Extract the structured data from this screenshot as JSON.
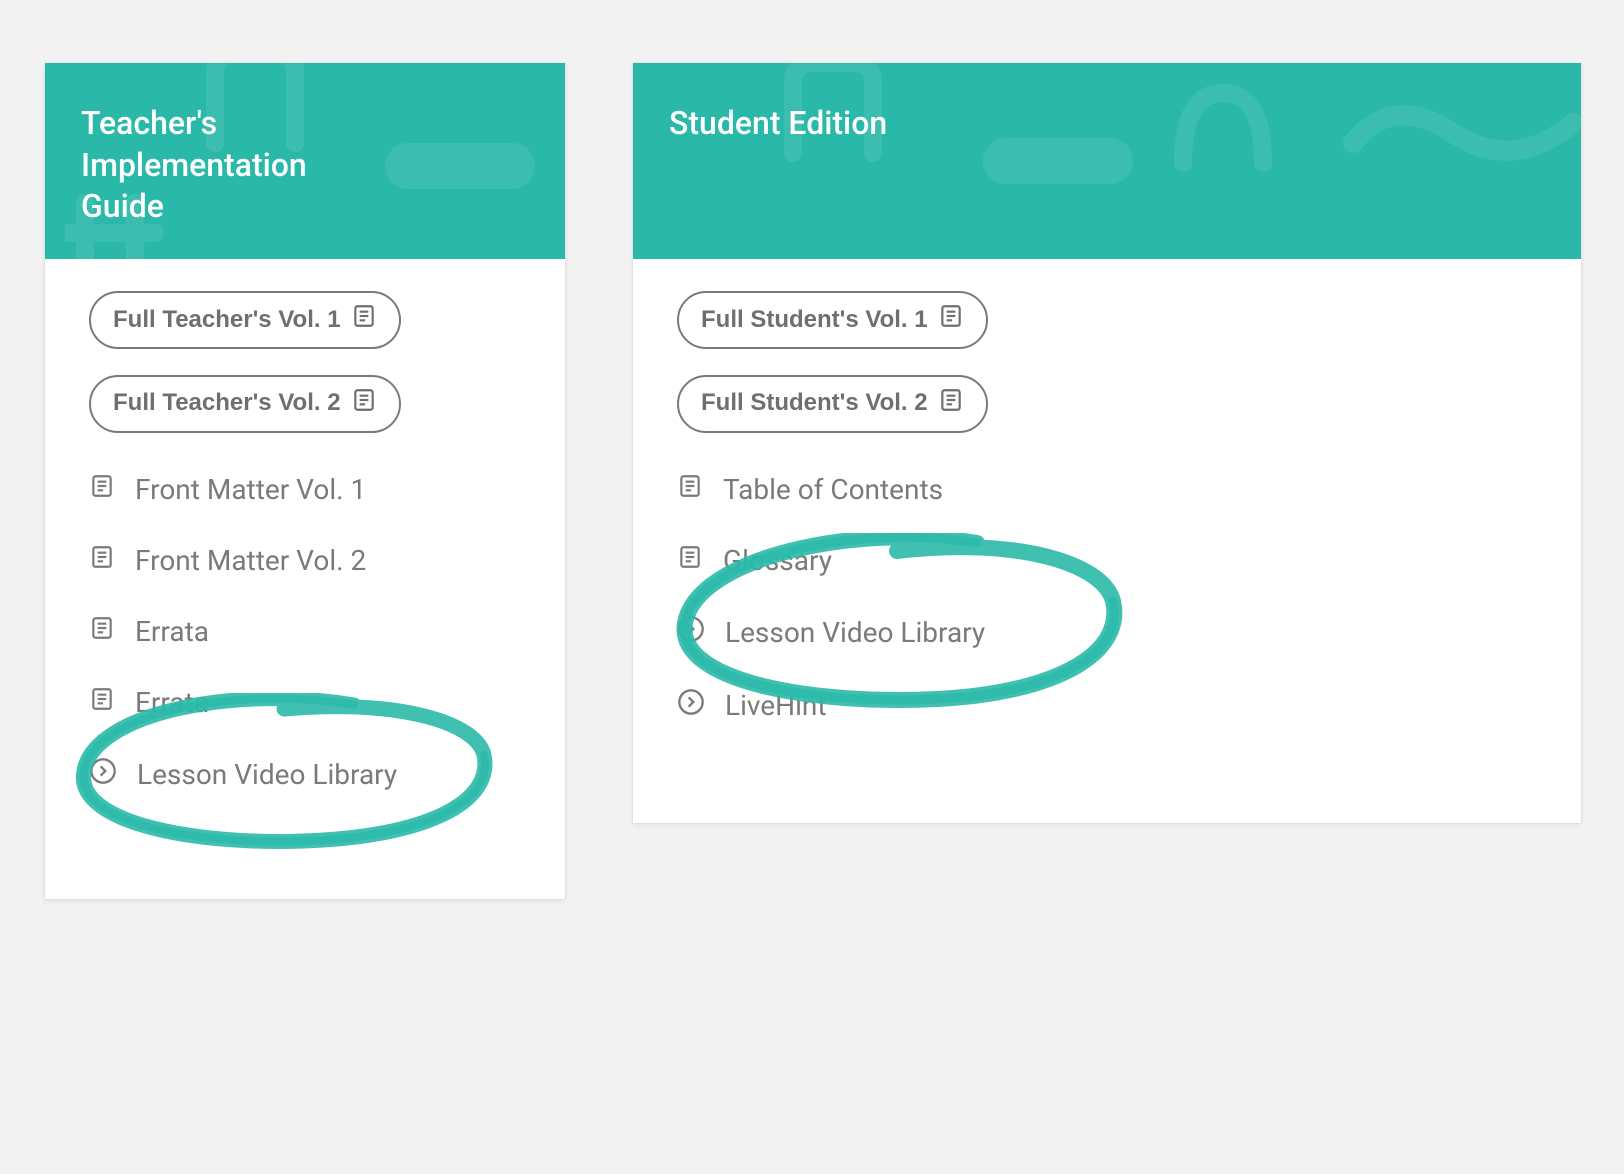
{
  "colors": {
    "accent": "#2ab9a8",
    "text_muted": "#7a7a7a"
  },
  "left": {
    "title": "Teacher's Implementation Guide",
    "buttons": [
      {
        "label": "Full Teacher's Vol. 1"
      },
      {
        "label": "Full Teacher's Vol. 2"
      }
    ],
    "items": [
      {
        "icon": "doc",
        "label": "Front Matter Vol. 1"
      },
      {
        "icon": "doc",
        "label": "Front Matter Vol. 2"
      },
      {
        "icon": "doc",
        "label": "Errata"
      },
      {
        "icon": "doc",
        "label": "Errata"
      },
      {
        "icon": "arrow",
        "label": "Lesson Video Library",
        "highlighted": true
      }
    ]
  },
  "right": {
    "title": "Student Edition",
    "buttons": [
      {
        "label": "Full Student's Vol. 1"
      },
      {
        "label": "Full Student's Vol. 2"
      }
    ],
    "items": [
      {
        "icon": "doc",
        "label": "Table of Contents"
      },
      {
        "icon": "doc",
        "label": "Glossary"
      },
      {
        "icon": "arrow",
        "label": "Lesson Video Library",
        "highlighted": true
      },
      {
        "icon": "arrow",
        "label": "LiveHint™"
      }
    ]
  }
}
